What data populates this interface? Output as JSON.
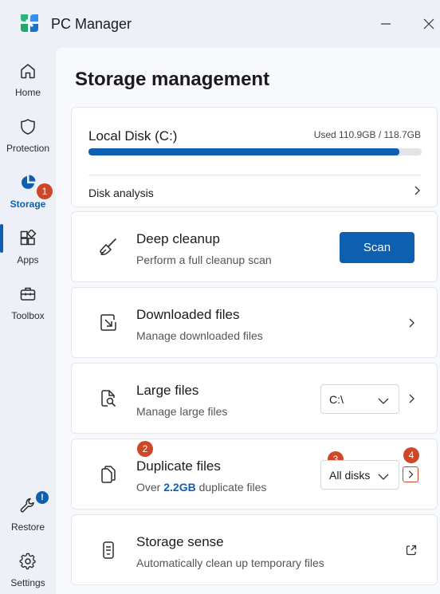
{
  "app": {
    "title": "PC Manager"
  },
  "colors": {
    "accent": "#0f5fb0",
    "badge": "#d04727"
  },
  "sidebar": {
    "items": [
      {
        "label": "Home",
        "icon": "home-icon"
      },
      {
        "label": "Protection",
        "icon": "shield-icon"
      },
      {
        "label": "Storage",
        "icon": "pie-chart-icon",
        "active": true,
        "badge": "1"
      },
      {
        "label": "Apps",
        "icon": "apps-grid-icon"
      },
      {
        "label": "Toolbox",
        "icon": "toolbox-icon"
      }
    ],
    "bottom": [
      {
        "label": "Restore",
        "icon": "wrench-icon",
        "badge": "!"
      },
      {
        "label": "Settings",
        "icon": "gear-icon"
      }
    ]
  },
  "page": {
    "title": "Storage management"
  },
  "disk": {
    "name": "Local Disk (C:)",
    "used_text": "Used 110.9GB / 118.7GB",
    "used_fraction": 0.934,
    "analysis_label": "Disk analysis"
  },
  "cards": {
    "deep_cleanup": {
      "title": "Deep cleanup",
      "subtitle": "Perform a full cleanup scan",
      "button": "Scan"
    },
    "downloaded": {
      "title": "Downloaded files",
      "subtitle": "Manage downloaded files"
    },
    "large": {
      "title": "Large files",
      "subtitle": "Manage large files",
      "select_value": "C:\\"
    },
    "duplicate": {
      "title": "Duplicate files",
      "subtitle_prefix": "Over ",
      "subtitle_highlight": "2.2GB",
      "subtitle_suffix": " duplicate files",
      "select_value": "All disks",
      "badges": [
        "2",
        "3",
        "4"
      ]
    },
    "storage_sense": {
      "title": "Storage sense",
      "subtitle": "Automatically clean up temporary files"
    }
  }
}
